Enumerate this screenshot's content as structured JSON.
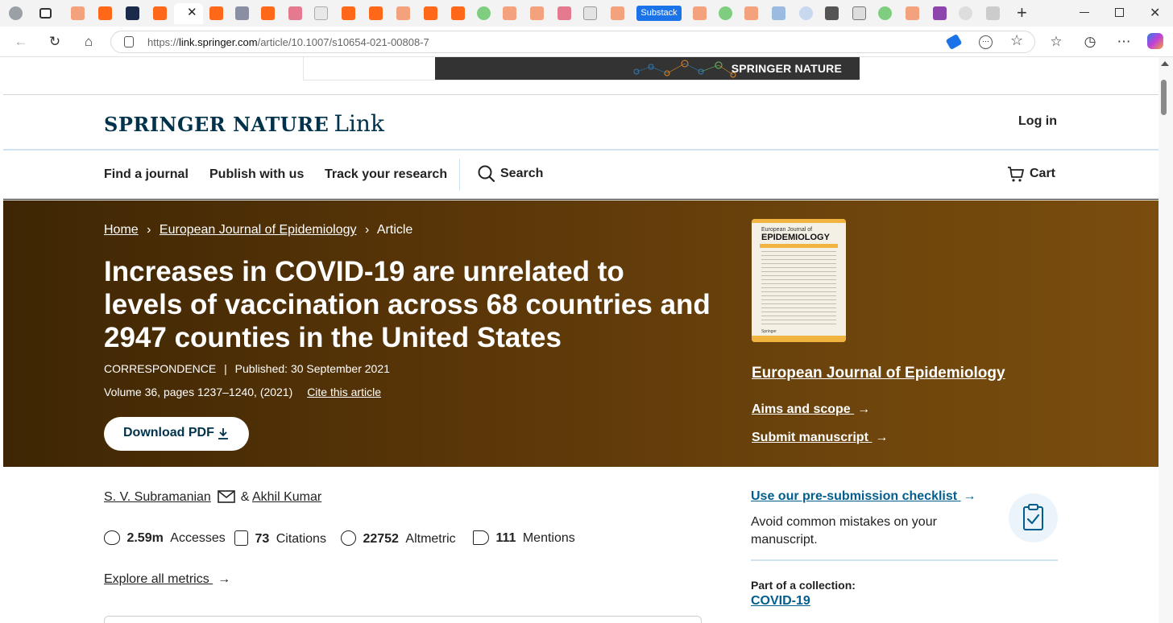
{
  "browser": {
    "active_tab_icon": "springer-icon",
    "tab_label": "Substack",
    "url_prefix": "https://",
    "url_host": "link.springer.com",
    "url_path": "/article/10.1007/s10654-021-00808-7"
  },
  "ad": {
    "brand": "SPRINGER NATURE"
  },
  "header": {
    "brand_main": "SPRINGER NATURE",
    "brand_sub": "Link",
    "login": "Log in"
  },
  "subnav": {
    "find": "Find a journal",
    "publish": "Publish with us",
    "track": "Track your research",
    "search": "Search",
    "cart": "Cart"
  },
  "breadcrumb": {
    "home": "Home",
    "sep1": "›",
    "journal": "European Journal of Epidemiology",
    "sep2": "›",
    "current": "Article"
  },
  "article": {
    "title_lines": [
      "Increases in COVID-19 are unrelated to",
      "levels of vaccination across 68 countries and",
      "2947 counties in the United States"
    ],
    "type": "CORRESPONDENCE",
    "published": "Published: 30 September 2021",
    "volume": "Volume 36, pages 1237–1240, (2021)",
    "cite": "Cite this article",
    "download": "Download PDF"
  },
  "journal": {
    "cover_small": "European Journal of",
    "cover_big": "EPIDEMIOLOGY",
    "cover_publisher": "Springer",
    "name": "European Journal of Epidemiology",
    "aims": "Aims and scope",
    "submit": "Submit manuscript"
  },
  "authors": {
    "a1": "S. V. Subramanian",
    "amp": "&",
    "a2": "Akhil Kumar"
  },
  "metrics": {
    "accesses_value": "2.59m",
    "accesses_label": "Accesses",
    "citations_value": "73",
    "citations_label": "Citations",
    "altmetric_value": "22752",
    "altmetric_label": "Altmetric",
    "mentions_value": "111",
    "mentions_label": "Mentions",
    "explore": "Explore all metrics"
  },
  "sidebar": {
    "checklist_link": "Use our pre-submission checklist",
    "checklist_text": "Avoid common mistakes on your manuscript.",
    "collection_label": "Part of a collection:",
    "collection_link": "COVID-19"
  },
  "colors": {
    "brand_navy": "#01324b",
    "link_blue": "#025e8d",
    "hero_brown": "#5a3608"
  }
}
